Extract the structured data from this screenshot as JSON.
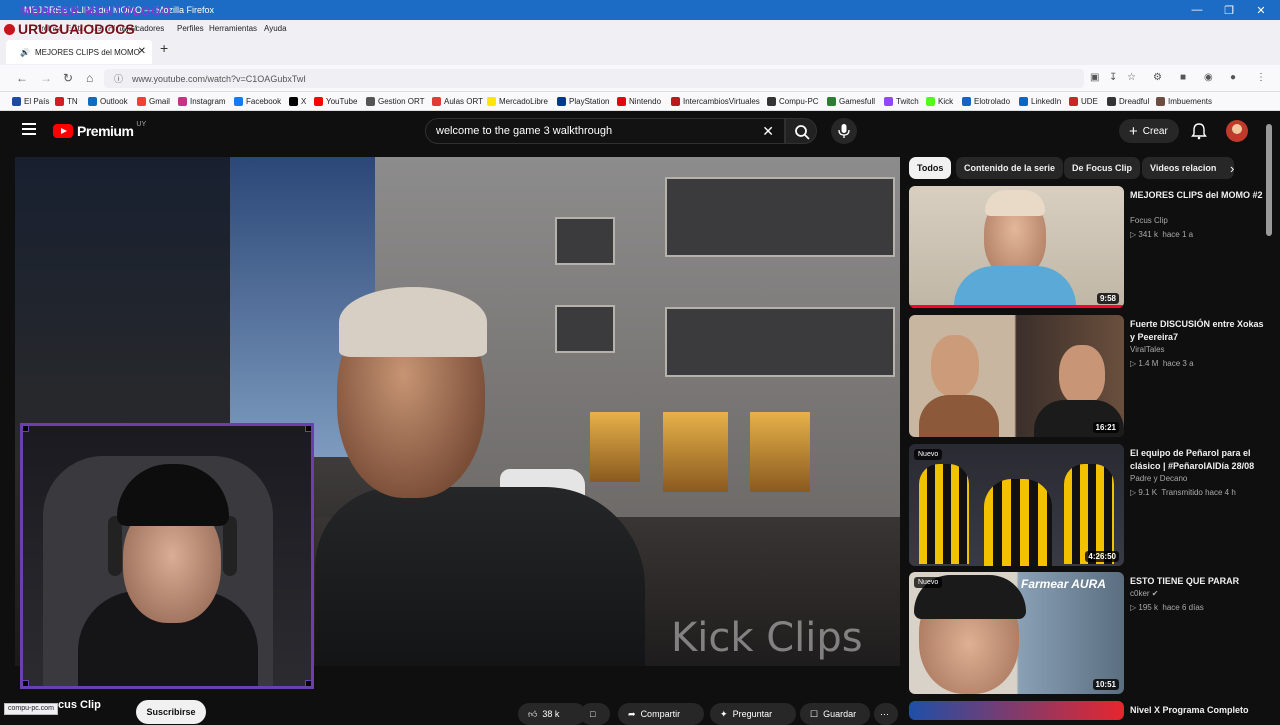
{
  "browser": {
    "title_text": "MEJORES CLIPS del MOMO — Mozilla Firefox",
    "stream_overlay": "MONGER MENTOLOGO",
    "brand_logo": "URUGUAIODOCS",
    "menu": [
      "Archivo",
      "Editar",
      "Ver",
      "Historial",
      "Marcadores",
      "Perfiles",
      "Herramientas",
      "Ayuda"
    ],
    "tab_title": "MEJORES CLIPS del MOMO",
    "url": "www.youtube.com/watch?v=C1OAGubxTwI",
    "status_url": "compu-pc.com",
    "bookmarks": [
      {
        "label": "El País",
        "color": "#1d4c9c"
      },
      {
        "label": "TN",
        "color": "#d81b22"
      },
      {
        "label": "Outlook",
        "color": "#0f6cbd"
      },
      {
        "label": "Gmail",
        "color": "#ea4335"
      },
      {
        "label": "Instagram",
        "color": "#c13584"
      },
      {
        "label": "Facebook",
        "color": "#1877f2"
      },
      {
        "label": "X",
        "color": "#000000"
      },
      {
        "label": "YouTube",
        "color": "#ff0000"
      },
      {
        "label": "Gestion ORT",
        "color": "#555555"
      },
      {
        "label": "Aulas ORT",
        "color": "#e53935"
      },
      {
        "label": "MercadoLibre",
        "color": "#ffe600"
      },
      {
        "label": "PlayStation",
        "color": "#003791"
      },
      {
        "label": "Nintendo",
        "color": "#e60012"
      },
      {
        "label": "IntercambiosVirtuales",
        "color": "#b71c1c"
      },
      {
        "label": "Compu-PC",
        "color": "#333333"
      },
      {
        "label": "Gamesfull",
        "color": "#2e7d32"
      },
      {
        "label": "Twitch",
        "color": "#9146ff"
      },
      {
        "label": "Kick",
        "color": "#53fc18"
      },
      {
        "label": "Elotrolado",
        "color": "#1565c0"
      },
      {
        "label": "LinkedIn",
        "color": "#0a66c2"
      },
      {
        "label": "UDE",
        "color": "#c62828"
      },
      {
        "label": "Dreadful",
        "color": "#333333"
      },
      {
        "label": "Imbuements",
        "color": "#6d4c41"
      }
    ]
  },
  "youtube": {
    "logo": "Premium",
    "country": "UY",
    "search_query": "welcome to the game 3 walkthrough",
    "create_label": "Crear",
    "watermark": "Kick Clips",
    "channel_name": "Focus Clip",
    "channel_name_visible": "cus Clip",
    "subscribe_label": "Suscribirse",
    "actions": {
      "likes": "38 k",
      "share": "Compartir",
      "ask": "Preguntar",
      "save": "Guardar"
    },
    "chips": [
      "Todos",
      "Contenido de la serie",
      "De Focus Clip",
      "Videos relacion"
    ],
    "recommendations": [
      {
        "title": "MEJORES CLIPS del MOMO #2",
        "channel": "Focus Clip",
        "views": "341 k",
        "age": "hace 1 a",
        "duration": "9:58",
        "new": false
      },
      {
        "title": "Fuerte DISCUSIÓN entre Xokas y Peereira7",
        "channel": "ViralTales",
        "views": "1.4 M",
        "age": "hace 3 a",
        "duration": "16:21",
        "new": false
      },
      {
        "title": "El equipo de Peñarol para el clásico | #PeñarolAlDía 28/08",
        "channel": "Padre y Decano",
        "views": "9.1 K",
        "age": "Transmitido hace 4 h",
        "duration": "4:26:50",
        "new": true,
        "new_label": "Nuevo"
      },
      {
        "title": "ESTO TIENE QUE PARAR",
        "channel": "c0ker",
        "views": "195 k",
        "age": "hace 6 días",
        "duration": "10:51",
        "new": true,
        "new_label": "Nuevo",
        "thumb_text": "Farmear AURA"
      },
      {
        "title": "Nivel X Programa Completo",
        "channel": "",
        "views": "",
        "age": "",
        "duration": "",
        "new": false
      }
    ]
  }
}
